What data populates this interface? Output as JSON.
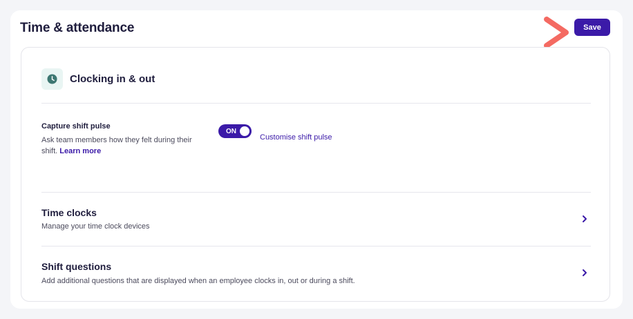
{
  "header": {
    "title": "Time & attendance",
    "save_label": "Save"
  },
  "section": {
    "title": "Clocking in & out",
    "icon": "clock-icon"
  },
  "shift_pulse": {
    "title": "Capture shift pulse",
    "description": "Ask team members how they felt during their shift.",
    "learn_more": "Learn more",
    "toggle_label": "ON",
    "toggle_on": true,
    "customise_link": "Customise shift pulse"
  },
  "rows": [
    {
      "title": "Time clocks",
      "description": "Manage your time clock devices"
    },
    {
      "title": "Shift questions",
      "description": "Add additional questions that are displayed when an employee clocks in, out or during a shift."
    }
  ],
  "colors": {
    "accent": "#3b1aa8",
    "arrow": "#f46a62",
    "clock_tile": "#e9f5f3",
    "clock_icon": "#3d7772"
  }
}
